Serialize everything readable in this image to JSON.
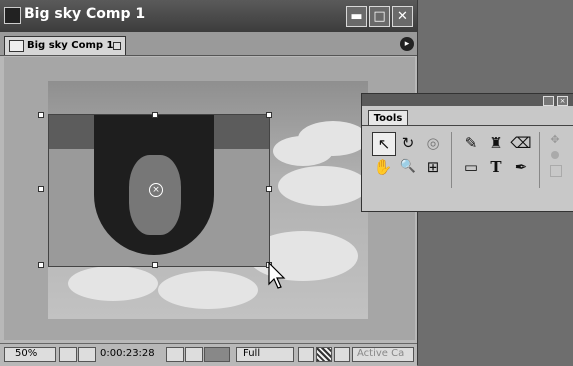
{
  "window": {
    "title": "Big sky Comp 1",
    "minimize_glyph": "▬",
    "maximize_glyph": "□",
    "close_glyph": "✕",
    "app_icon": "composition-icon"
  },
  "tab": {
    "label": "Big sky Comp 1",
    "menu_glyph": "▸"
  },
  "status_bar": {
    "zoom": "50%",
    "timecode": "0:00:23:28",
    "resolution": "Full",
    "view": "Active Ca"
  },
  "tools_palette": {
    "title": "Tools",
    "tools": [
      {
        "name": "selection-tool",
        "glyph": "↖"
      },
      {
        "name": "rotation-tool",
        "glyph": "↻"
      },
      {
        "name": "orbit-camera-tool",
        "glyph": "◎"
      },
      {
        "name": "brush-tool",
        "glyph": "✎"
      },
      {
        "name": "clone-stamp-tool",
        "glyph": "♜"
      },
      {
        "name": "eraser-tool",
        "glyph": "⌫"
      },
      {
        "name": "hand-tool",
        "glyph": "✋"
      },
      {
        "name": "zoom-tool",
        "glyph": "🔍"
      },
      {
        "name": "pan-behind-tool",
        "glyph": "⊞"
      },
      {
        "name": "rectangle-mask-tool",
        "glyph": "▭"
      },
      {
        "name": "type-tool",
        "glyph": "T"
      },
      {
        "name": "pen-tool",
        "glyph": "✒"
      }
    ]
  },
  "colors": {
    "titlebar": "#4a4a4a",
    "panel": "#b8b8b8",
    "desktop": "#6e6e6e"
  }
}
